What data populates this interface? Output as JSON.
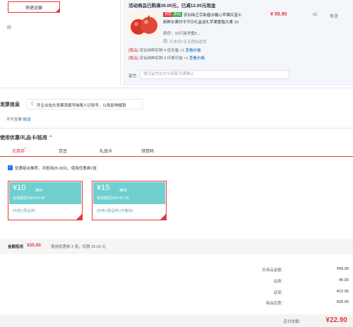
{
  "shipping": {
    "express_button": "快递运输",
    "rating_text": "好"
  },
  "order": {
    "promo_text": "活动商品已购满39.00元，已减12.00元现金",
    "product": {
      "tag_self": "自营",
      "tag_green": "京品",
      "title_line1": "农仙味正宗新疆冰糖心苹果红富士",
      "title_line2": "新鲜水果时令节日礼盒送礼苹果整箱大果 10",
      "price": "¥ 59.90",
      "qty": "x1",
      "stock": "有货",
      "color": "颜色：10斤装净重8...",
      "no_return": "不支持7天无理由退货"
    },
    "gifts": [
      {
        "tag": "[赠品]",
        "text": "农仙味鲜实物 4 优先箱 ×1",
        "link": "查看价格"
      },
      {
        "tag": "[赠品]",
        "text": "农仙味鲜实物 4 环果可装 ×1",
        "link": "查看价格"
      }
    ],
    "remark_label": "留言:",
    "remark_placeholder": "建议留言前先与商家沟通确认"
  },
  "invoice": {
    "title": "发票信息",
    "tip": "开企业抬头发票须填写纳税人识别号，以免影响报销",
    "value": "不开发票",
    "edit": "修改"
  },
  "coupons": {
    "title": "使用优惠/礼品卡/抵用",
    "tabs": [
      {
        "label": "优惠券",
        "active": true
      },
      {
        "label": "京豆",
        "active": false
      },
      {
        "label": "礼品卡",
        "active": false
      },
      {
        "label": "领货码",
        "active": false
      }
    ],
    "combo_label": "优惠组合推荐，共抵用25.00元，使用优惠券2张",
    "items": [
      {
        "amount": "¥10",
        "condition": "满39",
        "expire": "有效期至2024-02-02",
        "tags": "[东券] [限品类]"
      },
      {
        "amount": "¥15",
        "condition": "满59",
        "expire": "有效期至2024-01-20",
        "tags": "[东券] [限品类] [可叠加]"
      }
    ],
    "summary_label": "金额抵用",
    "summary_amount": "¥25.00",
    "summary_desc": "使用优惠券 2 张，优惠 25.00 元"
  },
  "totals": {
    "rows": [
      {
        "label": "总商品金额：",
        "value": "¥59.90"
      },
      {
        "label": "运费：",
        "value": "¥0.00"
      },
      {
        "label": "返现：",
        "value": "-¥12.00"
      },
      {
        "label": "商品优惠：",
        "value": "-¥25.00"
      }
    ],
    "payable_label": "应付总额：",
    "payable_value": "¥22.90"
  },
  "colors": {
    "accent": "#e4393c",
    "coupon": "#6fcfcf",
    "panel": "#f3f7fb"
  }
}
